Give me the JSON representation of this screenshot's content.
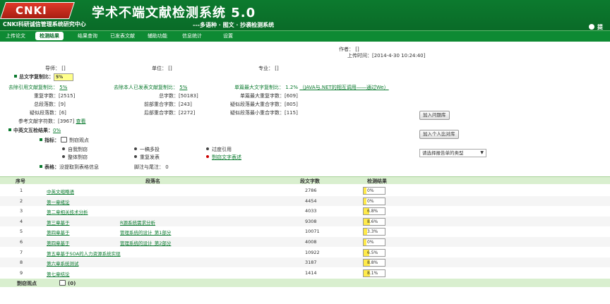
{
  "header": {
    "logo_text": "CNKI",
    "org": "CNKI科研诚信管理系统研究中心",
    "title": "学术不端文献检测系统 5.0",
    "subtitle": "---多语种 · 图文 · 抄袭检测系统",
    "help": "提"
  },
  "nav": [
    "上传论文",
    "检测结果",
    "结果查询",
    "已发表文献",
    "辅助功能",
    "信息统计",
    "设置"
  ],
  "meta": {
    "author_label": "作者：",
    "author_value": "[]",
    "upload_label": "上传时间：",
    "upload_value": "[2014-4-30 10:24:40]",
    "tutor_label": "导师：",
    "tutor_value": "[]",
    "unit_label": "单位：",
    "unit_value": "[]",
    "major_label": "专业：",
    "major_value": "[]"
  },
  "summary": {
    "total_copy_label": "总文字复制比：",
    "total_copy_value": "5%",
    "excl_ref_label": "去除引用文献复制比：",
    "excl_ref_value": "5%",
    "excl_self_label": "去除本人已发表文献复制比：",
    "excl_self_value": "5%",
    "single_max_label": "单篇最大文字复制比：",
    "single_max_value": "1.2%",
    "single_max_link": "（JAVA与.NET的相互调用――通过We）",
    "dup_chars_label": "重复字数：",
    "dup_chars_value": "[2515]",
    "total_chars_label": "总字数：",
    "total_chars_value": "[50183]",
    "single_max_dup_label": "单篇最大重复字数：",
    "single_max_dup_value": "[609]",
    "total_paras_label": "总段落数：",
    "total_paras_value": "[9]",
    "front_dup_label": "前部重合字数：",
    "front_dup_value": "[243]",
    "susp_max_label": "疑似段落最大重合字数：",
    "susp_max_value": "[805]",
    "susp_paras_label": "疑似段落数：",
    "susp_paras_value": "[6]",
    "back_dup_label": "后部重合字数：",
    "back_dup_value": "[2272]",
    "susp_min_label": "疑似段落最小重合字数：",
    "susp_min_value": "[115]",
    "ref_chars_label": "参考文献字符数：",
    "ref_chars_value": "[3967]",
    "view_link": "查看",
    "cross_label": "中英文互检结果：",
    "cross_value": "0%",
    "indicator_label": "指标：",
    "plag_view": "剽窃观点",
    "ind_self": "自我剽窃",
    "ind_whole": "整体剽窃",
    "ind_multi": "一稿多投",
    "ind_repeat": "重复发表",
    "ind_overcite": "过度引用",
    "ind_textplag": "剽窃文字表述",
    "table_label": "表格：",
    "table_value": "没提取到表格信息",
    "footnote_label": "脚注与尾注：",
    "footnote_value": "0"
  },
  "actions": {
    "add_question": "加入问题库",
    "add_personal": "加入个人比对库",
    "report_type_placeholder": "请选择报告单的类型"
  },
  "table": {
    "headers": [
      "序号",
      "段落名",
      "段文字数",
      "检测结果"
    ],
    "rows": [
      {
        "no": "1",
        "name": "中英文缩略语",
        "name2": "",
        "chars": "2786",
        "result": "0%",
        "pct": 0
      },
      {
        "no": "2",
        "name": "第一章绪论",
        "name2": "",
        "chars": "4454",
        "result": "0%",
        "pct": 0
      },
      {
        "no": "3",
        "name": "第二章相关技术分析",
        "name2": "",
        "chars": "4033",
        "result": "6.8%",
        "pct": 6.8
      },
      {
        "no": "4",
        "name": "第三章基于",
        "name2": "R源系统需求分析",
        "chars": "9308",
        "result": "8.6%",
        "pct": 8.6
      },
      {
        "no": "5",
        "name": "第四章基于",
        "name2": "管理系统的设计_第1部分",
        "chars": "10071",
        "result": "3.3%",
        "pct": 3.3
      },
      {
        "no": "6",
        "name": "第四章基于",
        "name2": "管理系统的设计_第2部分",
        "chars": "4008",
        "result": "0%",
        "pct": 0
      },
      {
        "no": "7",
        "name": "第五章基于SOA的人力资源系统实现",
        "name2": "",
        "chars": "10922",
        "result": "6.5%",
        "pct": 6.5
      },
      {
        "no": "8",
        "name": "第六章系统测试",
        "name2": "",
        "chars": "3187",
        "result": "8.8%",
        "pct": 8.8
      },
      {
        "no": "9",
        "name": "第七章结论",
        "name2": "",
        "chars": "1414",
        "result": "8.1%",
        "pct": 8.1
      }
    ],
    "footer_label": "剽窃观点",
    "footer_value": "(0)"
  }
}
